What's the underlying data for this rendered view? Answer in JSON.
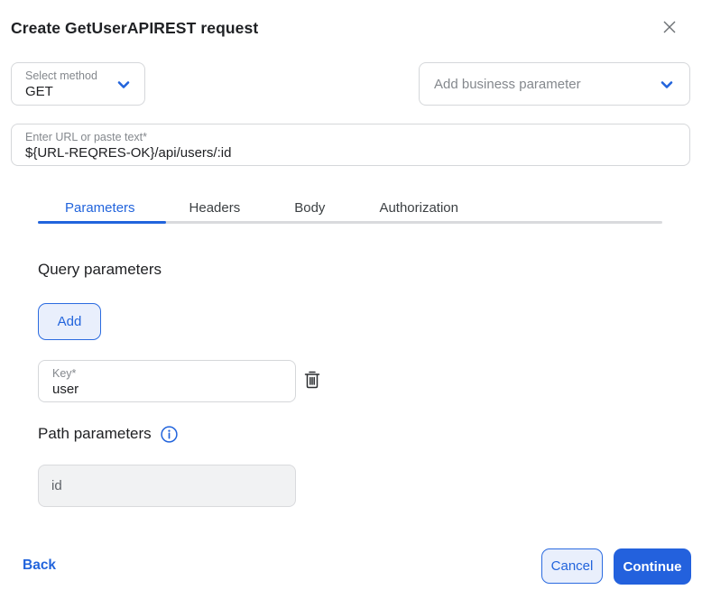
{
  "dialog": {
    "title": "Create GetUserAPIREST request"
  },
  "method_select": {
    "label": "Select method",
    "value": "GET"
  },
  "business_param_select": {
    "placeholder": "Add business parameter"
  },
  "url_field": {
    "label": "Enter URL or paste text*",
    "value": "${URL-REQRES-OK}/api/users/:id"
  },
  "tabs": [
    {
      "label": "Parameters",
      "active": true
    },
    {
      "label": "Headers",
      "active": false
    },
    {
      "label": "Body",
      "active": false
    },
    {
      "label": "Authorization",
      "active": false
    }
  ],
  "query_section": {
    "heading": "Query parameters",
    "add_button_label": "Add",
    "key_field": {
      "label": "Key*",
      "value": "user"
    }
  },
  "path_section": {
    "heading": "Path parameters",
    "field_value": "id"
  },
  "footer": {
    "back_label": "Back",
    "cancel_label": "Cancel",
    "continue_label": "Continue"
  },
  "colors": {
    "accent": "#2264dc",
    "continue_bg": "#2361dd",
    "tonal_bg": "#e9effc",
    "tonal_border": "#2b6be0",
    "border": "#d5d7da",
    "label_gray": "#84888d",
    "text_dark": "#202124",
    "track_gray": "#d9dadd",
    "disabled_bg": "#f1f2f3"
  },
  "icons": {
    "close": "close-icon",
    "chevron": "chevron-down-icon",
    "trash": "trash-icon",
    "info": "info-icon"
  }
}
